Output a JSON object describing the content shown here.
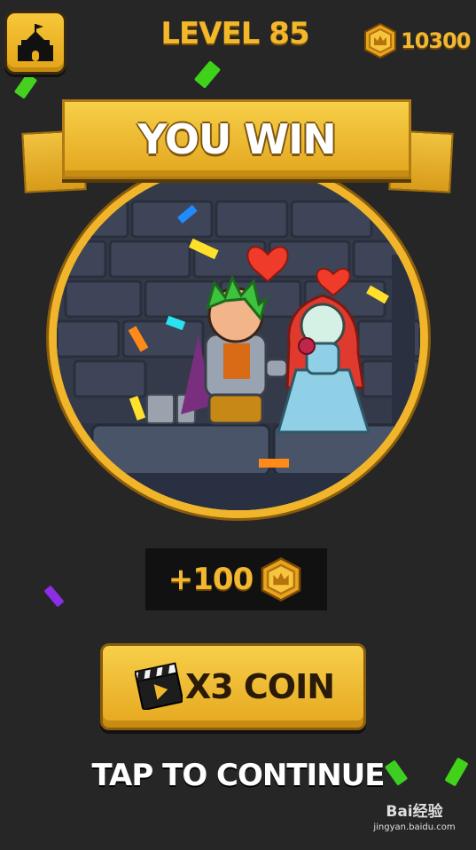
{
  "header": {
    "level_title": "LEVEL 85",
    "coin_total": "10300"
  },
  "banner": {
    "title": "YOU WIN"
  },
  "reward": {
    "amount": "+100"
  },
  "x3_button": {
    "label": "X3 COIN"
  },
  "footer": {
    "tap_to_continue": "TAP TO CONTINUE"
  },
  "watermark": {
    "main": "Bai经验",
    "sub": "jingyan.baidu.com"
  },
  "icons": [
    "castle-icon",
    "coin-icon",
    "video-clapper-icon",
    "heart-icon"
  ],
  "colors": {
    "gold": "#f0b52a",
    "background": "#262626",
    "reward_bg": "#111111"
  }
}
